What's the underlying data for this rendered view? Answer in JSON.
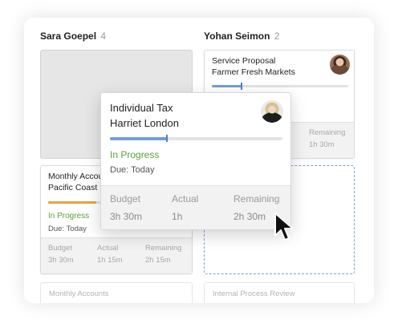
{
  "columns": [
    {
      "name": "Sara Goepel",
      "count": "4"
    },
    {
      "name": "Yohan Seimon",
      "count": "2"
    }
  ],
  "cards": {
    "service_proposal": {
      "title_line1": "Service Proposal",
      "title_line2": "Farmer Fresh Markets",
      "progress": 0.22,
      "remaining_label": "Remaining",
      "remaining_value": "1h 30m"
    },
    "monthly_pacific": {
      "title_line1": "Monthly Accou",
      "title_line2": "Pacific Coast",
      "status": "In Progress",
      "due": "Due: Today",
      "progress": 0.35,
      "budget_label": "Budget",
      "budget_value": "3h 30m",
      "actual_label": "Actual",
      "actual_value": "1h 15m",
      "remaining_label": "Remaining",
      "remaining_value": "2h 15m"
    },
    "monthly_accounts": {
      "title": "Monthly Accounts"
    },
    "internal_review": {
      "title": "Internal Process Review"
    }
  },
  "popover": {
    "title_line1": "Individual Tax",
    "title_line2": "Harriet London",
    "status": "In Progress",
    "due": "Due: Today",
    "progress": 0.33,
    "budget_label": "Budget",
    "budget_value": "3h 30m",
    "actual_label": "Actual",
    "actual_value": "1h",
    "remaining_label": "Remaining",
    "remaining_value": "2h 30m"
  },
  "colors": {
    "status_green": "#5aa13a",
    "progress_blue": "#6f9fe0",
    "progress_orange": "#e8a33a",
    "drop_zone": "#7ea1d6"
  }
}
